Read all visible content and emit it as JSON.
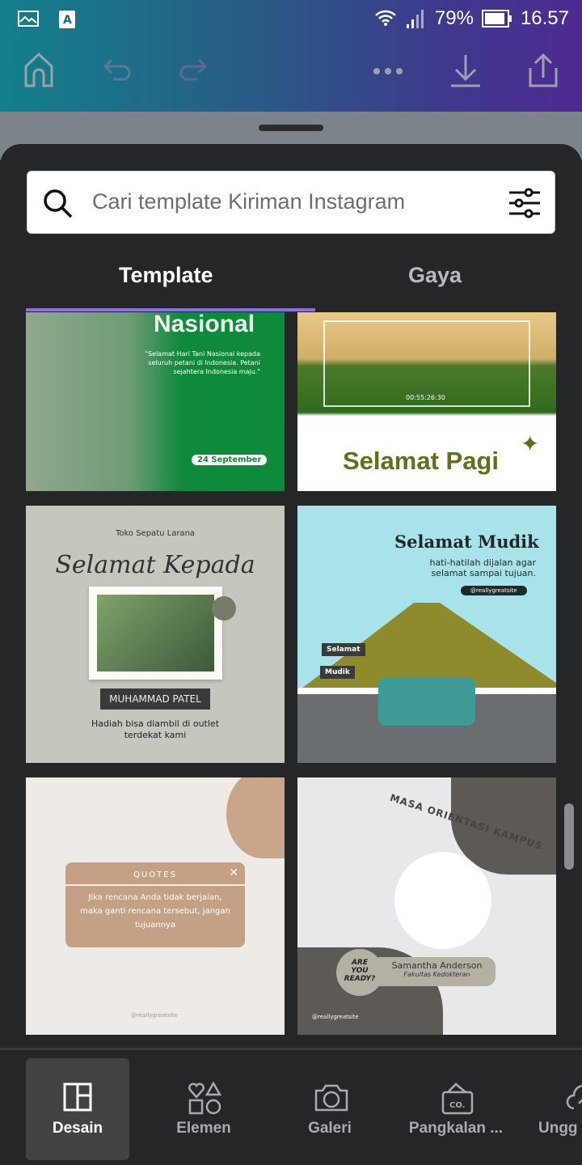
{
  "status_bar": {
    "battery": "79%",
    "time": "16.57",
    "icons": [
      "image-icon",
      "app-a-icon",
      "wifi-icon",
      "signal-icon",
      "battery-icon"
    ]
  },
  "toolbar": {
    "icons": [
      "home-icon",
      "undo-icon",
      "redo-icon",
      "more-icon",
      "download-icon",
      "share-icon"
    ]
  },
  "search": {
    "placeholder": "Cari template Kiriman Instagram"
  },
  "tabs": [
    {
      "label": "Template",
      "active": true
    },
    {
      "label": "Gaya",
      "active": false
    }
  ],
  "accent": "#8b6cf0",
  "templates": [
    {
      "title": "Nasional",
      "body": "\"Selamat Hari Tani Nasional kepada seluruh petani di Indonesia. Petani sejahtera Indonesia maju.\"",
      "badge": "24 September"
    },
    {
      "title": "Selamat Pagi",
      "timecode": "00:55:26:30"
    },
    {
      "brand": "Toko Sepatu Larana",
      "title": "Selamat Kepada",
      "name": "MUHAMMAD PATEL",
      "body": "Hadiah bisa diambil di outlet terdekat kami"
    },
    {
      "title": "Selamat Mudik",
      "body": "hati-hatilah dijalan agar selamat sampai tujuan.",
      "handle": "@reallygreatsite",
      "sign1": "Selamat",
      "sign2": "Mudik"
    },
    {
      "header": "QUOTES",
      "body": "Jika rencana Anda tidak berjalan, maka ganti rencana tersebut, jangan tujuannya",
      "handle": "@reallygreatsite"
    },
    {
      "title": "MASA ORIENTASI KAMPUS",
      "badge": "ARE YOU READY?",
      "name": "Samantha Anderson",
      "subtitle": "Fakultas Kedokteran",
      "handle": "@reallygreatsite"
    }
  ],
  "bottom_nav": [
    {
      "label": "Desain",
      "icon": "layout-icon",
      "active": true
    },
    {
      "label": "Elemen",
      "icon": "shapes-icon"
    },
    {
      "label": "Galeri",
      "icon": "camera-icon"
    },
    {
      "label": "Pangkalan ...",
      "icon": "stock-icon"
    },
    {
      "label": "Ungg",
      "icon": "upload-cloud-icon"
    }
  ]
}
